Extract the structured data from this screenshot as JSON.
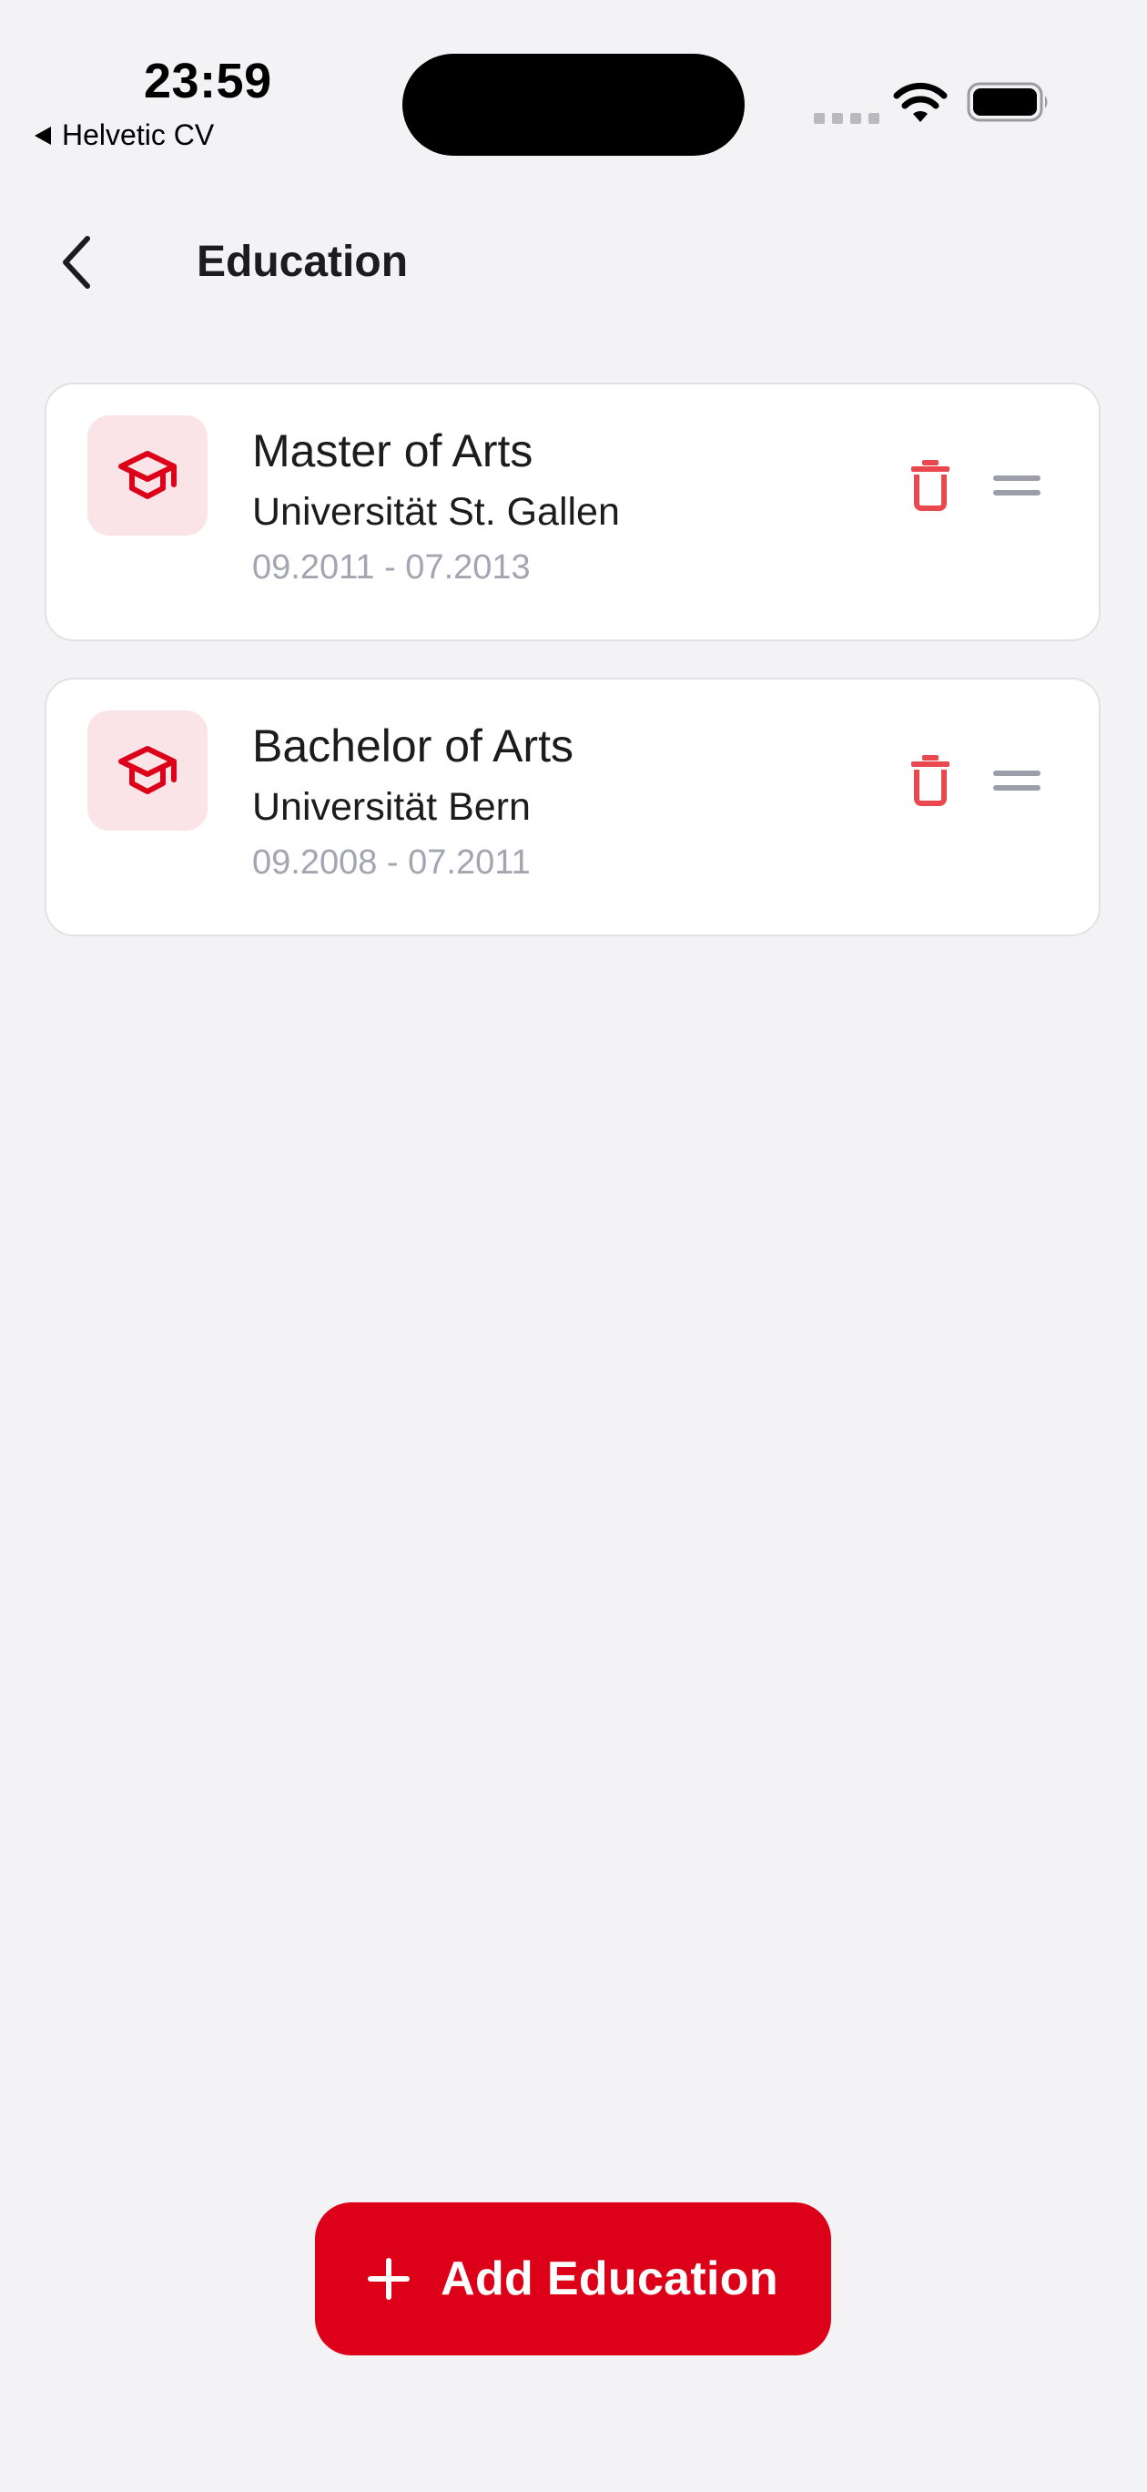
{
  "status_bar": {
    "time": "23:59",
    "back_app": "Helvetic CV"
  },
  "nav": {
    "title": "Education"
  },
  "education": [
    {
      "degree": "Master of Arts",
      "school": "Universität St. Gallen",
      "dates": "09.2011 - 07.2013"
    },
    {
      "degree": "Bachelor of Arts",
      "school": "Universität Bern",
      "dates": "09.2008 - 07.2011"
    }
  ],
  "actions": {
    "add_label": "Add Education"
  },
  "colors": {
    "accent": "#dc0018",
    "icon_tile": "#fbe4e8",
    "trash": "#e8484e",
    "muted": "#a3a6b0",
    "background": "#f3f3f6"
  },
  "icons": {
    "back": "chevron-left-icon",
    "education": "graduation-cap-icon",
    "delete": "trash-icon",
    "reorder": "drag-handle-icon",
    "add": "plus-icon"
  }
}
